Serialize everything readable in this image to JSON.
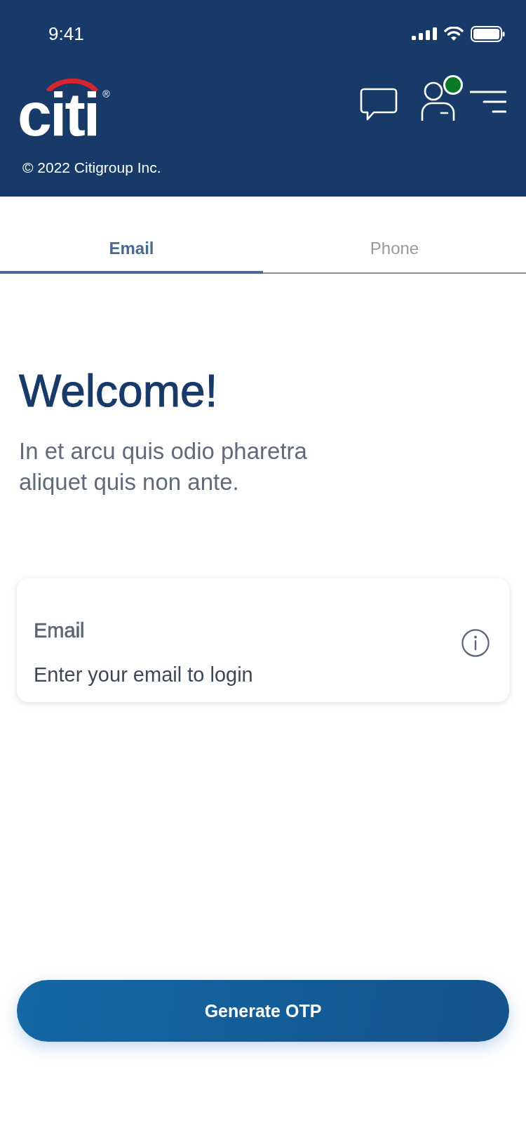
{
  "status_bar": {
    "time": "9:41"
  },
  "header": {
    "logo": {
      "text": "citi",
      "mark": "®"
    },
    "copyright": "© 2022 Citigroup Inc.",
    "profile": {
      "online": true
    }
  },
  "tabs": [
    {
      "label": "Email",
      "selected": true
    },
    {
      "label": "Phone",
      "selected": false
    }
  ],
  "welcome": {
    "title": "Welcome!",
    "subtitle": "In et arcu quis odio pharetra aliquet quis non ante."
  },
  "email_field": {
    "label": "Email",
    "placeholder": "Enter your email to login"
  },
  "primary_button": {
    "label": "Generate OTP"
  }
}
